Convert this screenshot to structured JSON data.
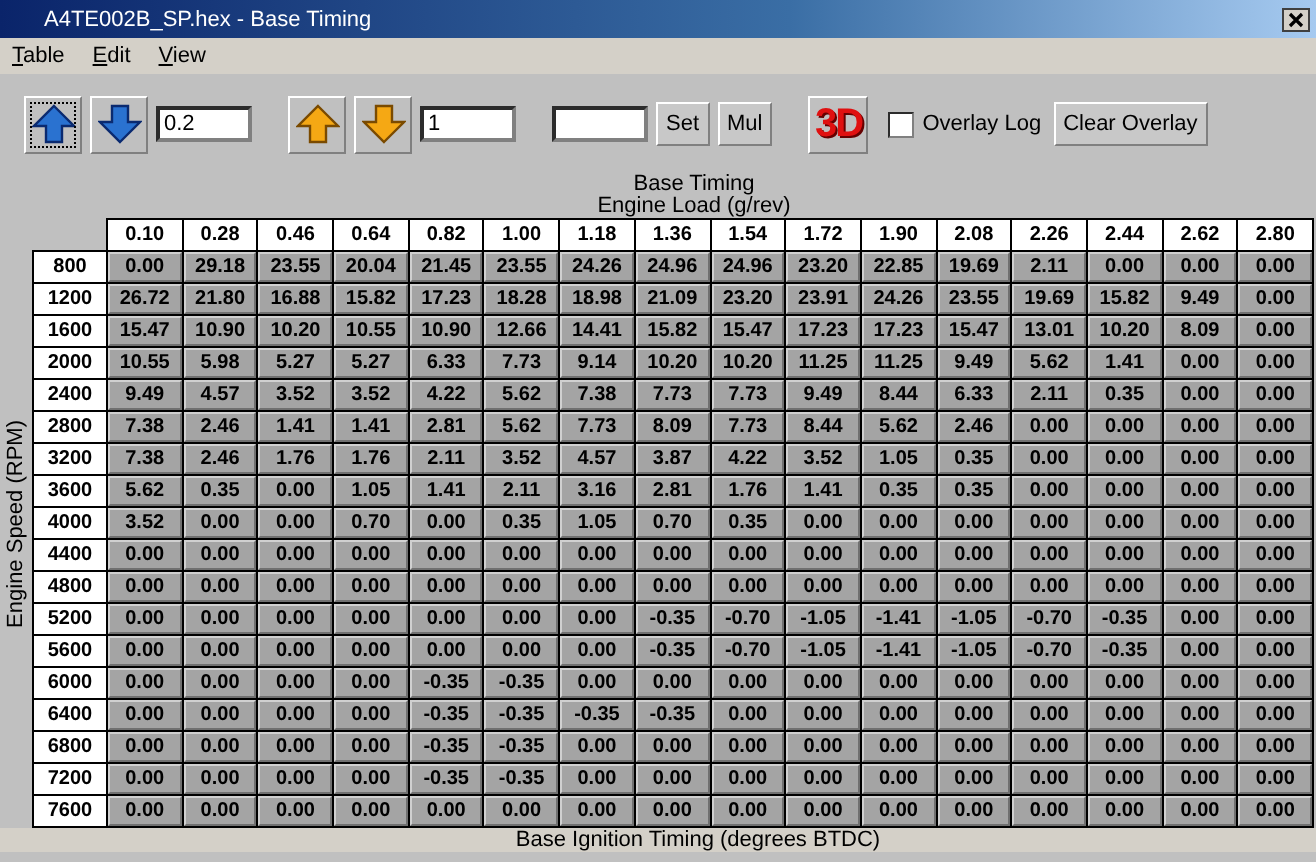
{
  "window": {
    "title": "A4TE002B_SP.hex - Base Timing"
  },
  "menu": [
    "Table",
    "Edit",
    "View"
  ],
  "toolbar": {
    "step_small": "0.2",
    "step_large": "1",
    "set": "Set",
    "mul": "Mul",
    "view3d": "3D",
    "overlay_log": {
      "label": "Overlay Log",
      "checked": false
    },
    "clear_overlay": "Clear Overlay"
  },
  "table": {
    "title": "Base Timing",
    "x_label": "Engine Load (g/rev)",
    "y_label": "Engine Speed (RPM)",
    "z_label": "Base Ignition Timing (degrees BTDC)",
    "columns": [
      "0.10",
      "0.28",
      "0.46",
      "0.64",
      "0.82",
      "1.00",
      "1.18",
      "1.36",
      "1.54",
      "1.72",
      "1.90",
      "2.08",
      "2.26",
      "2.44",
      "2.62",
      "2.80"
    ],
    "rows": [
      {
        "rpm": "800",
        "values": [
          "0.00",
          "29.18",
          "23.55",
          "20.04",
          "21.45",
          "23.55",
          "24.26",
          "24.96",
          "24.96",
          "23.20",
          "22.85",
          "19.69",
          "2.11",
          "0.00",
          "0.00",
          "0.00"
        ]
      },
      {
        "rpm": "1200",
        "values": [
          "26.72",
          "21.80",
          "16.88",
          "15.82",
          "17.23",
          "18.28",
          "18.98",
          "21.09",
          "23.20",
          "23.91",
          "24.26",
          "23.55",
          "19.69",
          "15.82",
          "9.49",
          "0.00"
        ]
      },
      {
        "rpm": "1600",
        "values": [
          "15.47",
          "10.90",
          "10.20",
          "10.55",
          "10.90",
          "12.66",
          "14.41",
          "15.82",
          "15.47",
          "17.23",
          "17.23",
          "15.47",
          "13.01",
          "10.20",
          "8.09",
          "0.00"
        ]
      },
      {
        "rpm": "2000",
        "values": [
          "10.55",
          "5.98",
          "5.27",
          "5.27",
          "6.33",
          "7.73",
          "9.14",
          "10.20",
          "10.20",
          "11.25",
          "11.25",
          "9.49",
          "5.62",
          "1.41",
          "0.00",
          "0.00"
        ]
      },
      {
        "rpm": "2400",
        "values": [
          "9.49",
          "4.57",
          "3.52",
          "3.52",
          "4.22",
          "5.62",
          "7.38",
          "7.73",
          "7.73",
          "9.49",
          "8.44",
          "6.33",
          "2.11",
          "0.35",
          "0.00",
          "0.00"
        ]
      },
      {
        "rpm": "2800",
        "values": [
          "7.38",
          "2.46",
          "1.41",
          "1.41",
          "2.81",
          "5.62",
          "7.73",
          "8.09",
          "7.73",
          "8.44",
          "5.62",
          "2.46",
          "0.00",
          "0.00",
          "0.00",
          "0.00"
        ]
      },
      {
        "rpm": "3200",
        "values": [
          "7.38",
          "2.46",
          "1.76",
          "1.76",
          "2.11",
          "3.52",
          "4.57",
          "3.87",
          "4.22",
          "3.52",
          "1.05",
          "0.35",
          "0.00",
          "0.00",
          "0.00",
          "0.00"
        ]
      },
      {
        "rpm": "3600",
        "values": [
          "5.62",
          "0.35",
          "0.00",
          "1.05",
          "1.41",
          "2.11",
          "3.16",
          "2.81",
          "1.76",
          "1.41",
          "0.35",
          "0.35",
          "0.00",
          "0.00",
          "0.00",
          "0.00"
        ]
      },
      {
        "rpm": "4000",
        "values": [
          "3.52",
          "0.00",
          "0.00",
          "0.70",
          "0.00",
          "0.35",
          "1.05",
          "0.70",
          "0.35",
          "0.00",
          "0.00",
          "0.00",
          "0.00",
          "0.00",
          "0.00",
          "0.00"
        ]
      },
      {
        "rpm": "4400",
        "values": [
          "0.00",
          "0.00",
          "0.00",
          "0.00",
          "0.00",
          "0.00",
          "0.00",
          "0.00",
          "0.00",
          "0.00",
          "0.00",
          "0.00",
          "0.00",
          "0.00",
          "0.00",
          "0.00"
        ]
      },
      {
        "rpm": "4800",
        "values": [
          "0.00",
          "0.00",
          "0.00",
          "0.00",
          "0.00",
          "0.00",
          "0.00",
          "0.00",
          "0.00",
          "0.00",
          "0.00",
          "0.00",
          "0.00",
          "0.00",
          "0.00",
          "0.00"
        ]
      },
      {
        "rpm": "5200",
        "values": [
          "0.00",
          "0.00",
          "0.00",
          "0.00",
          "0.00",
          "0.00",
          "0.00",
          "-0.35",
          "-0.70",
          "-1.05",
          "-1.41",
          "-1.05",
          "-0.70",
          "-0.35",
          "0.00",
          "0.00"
        ]
      },
      {
        "rpm": "5600",
        "values": [
          "0.00",
          "0.00",
          "0.00",
          "0.00",
          "0.00",
          "0.00",
          "0.00",
          "-0.35",
          "-0.70",
          "-1.05",
          "-1.41",
          "-1.05",
          "-0.70",
          "-0.35",
          "0.00",
          "0.00"
        ]
      },
      {
        "rpm": "6000",
        "values": [
          "0.00",
          "0.00",
          "0.00",
          "0.00",
          "-0.35",
          "-0.35",
          "0.00",
          "0.00",
          "0.00",
          "0.00",
          "0.00",
          "0.00",
          "0.00",
          "0.00",
          "0.00",
          "0.00"
        ]
      },
      {
        "rpm": "6400",
        "values": [
          "0.00",
          "0.00",
          "0.00",
          "0.00",
          "-0.35",
          "-0.35",
          "-0.35",
          "-0.35",
          "0.00",
          "0.00",
          "0.00",
          "0.00",
          "0.00",
          "0.00",
          "0.00",
          "0.00"
        ]
      },
      {
        "rpm": "6800",
        "values": [
          "0.00",
          "0.00",
          "0.00",
          "0.00",
          "-0.35",
          "-0.35",
          "0.00",
          "0.00",
          "0.00",
          "0.00",
          "0.00",
          "0.00",
          "0.00",
          "0.00",
          "0.00",
          "0.00"
        ]
      },
      {
        "rpm": "7200",
        "values": [
          "0.00",
          "0.00",
          "0.00",
          "0.00",
          "-0.35",
          "-0.35",
          "0.00",
          "0.00",
          "0.00",
          "0.00",
          "0.00",
          "0.00",
          "0.00",
          "0.00",
          "0.00",
          "0.00"
        ]
      },
      {
        "rpm": "7600",
        "values": [
          "0.00",
          "0.00",
          "0.00",
          "0.00",
          "0.00",
          "0.00",
          "0.00",
          "0.00",
          "0.00",
          "0.00",
          "0.00",
          "0.00",
          "0.00",
          "0.00",
          "0.00",
          "0.00"
        ]
      }
    ]
  }
}
